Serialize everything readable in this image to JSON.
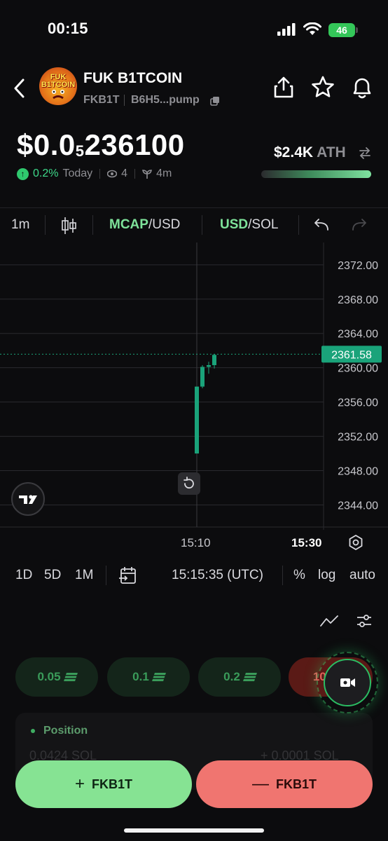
{
  "status_bar": {
    "time": "00:15",
    "battery": "46"
  },
  "header": {
    "name": "FUK B1TCOIN",
    "ticker": "FKB1T",
    "address": "B6H5...pump",
    "avatar_text_top": "FUK",
    "avatar_text_bottom": "B1TCOIN"
  },
  "price": {
    "prefix": "$0.0",
    "subscript": "5",
    "digits": "236100",
    "change": "0.2%",
    "period": "Today",
    "watchers": "4",
    "age": "4m",
    "ath_value": "$2.4K",
    "ath_label": "ATH"
  },
  "toolbar": {
    "interval": "1m",
    "mcap_active": "MCAP",
    "mcap_rest": "/USD",
    "usd_active": "USD",
    "usd_rest": "/SOL"
  },
  "chart_data": {
    "type": "candlestick",
    "y_ticks": [
      "2372.00",
      "2368.00",
      "2364.00",
      "2360.00",
      "2356.00",
      "2352.00",
      "2348.00",
      "2344.00"
    ],
    "ylim": [
      2341.1,
      2374.6
    ],
    "current_price": "2361.58",
    "current_value": 2361.58,
    "x_ticks": [
      "15:10",
      "15:30"
    ],
    "candles": [
      {
        "open": 2350.0,
        "close": 2357.8,
        "high": 2357.8,
        "low": 2350.0
      },
      {
        "open": 2357.8,
        "close": 2360.1,
        "high": 2360.3,
        "low": 2357.6
      },
      {
        "open": 2360.1,
        "close": 2360.3,
        "high": 2360.7,
        "low": 2359.3
      },
      {
        "open": 2360.3,
        "close": 2361.5,
        "high": 2361.6,
        "low": 2359.9
      }
    ],
    "colors": {
      "up": "#1aa37a",
      "grid": "#2a2a2e"
    }
  },
  "bottom_bar": {
    "ranges": [
      "1D",
      "5D",
      "1M"
    ],
    "time_utc": "15:15:35 (UTC)",
    "percent": "%",
    "log": "log",
    "auto": "auto"
  },
  "amounts": [
    {
      "label": "0.05"
    },
    {
      "label": "0.1"
    },
    {
      "label": "0.2"
    },
    {
      "label": "100"
    }
  ],
  "position": {
    "label": "Position",
    "left_value": "0.0424 SOL",
    "right_value": "+ 0.0001 SOL"
  },
  "actions": {
    "buy": "FKB1T",
    "sell": "FKB1T"
  }
}
